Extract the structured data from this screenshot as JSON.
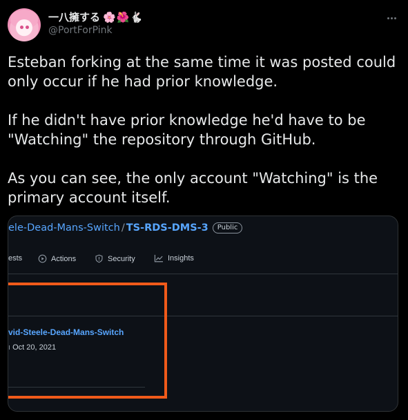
{
  "author": {
    "display_name": "一八擁する",
    "emoji": "🌸🌺🐇",
    "handle": "@PortForPink",
    "avatar_icon": "anime-avatar-icon"
  },
  "tweet": {
    "paragraphs": [
      [
        "Esteban forking at the same time it was posted could",
        "only occur if he had prior knowledge."
      ],
      [
        "If he didn't have prior knowledge he'd have to be",
        "\"Watching\" the repository through GitHub."
      ],
      [
        "As you can see, the only account \"Watching\" is the",
        "primary account itself."
      ]
    ]
  },
  "screenshot": {
    "repo_owner": "ele-Dead-Mans-Switch",
    "repo_separator": "/",
    "repo_name": "TS-RDS-DMS-3",
    "visibility_badge": "Public",
    "tabs": [
      {
        "label": "ests",
        "icon": ""
      },
      {
        "label": "Actions",
        "icon": "play-circle-icon"
      },
      {
        "label": "Security",
        "icon": "shield-icon"
      },
      {
        "label": "Insights",
        "icon": "graph-icon"
      }
    ],
    "watcher_name": "vid-Steele-Dead-Mans-Switch",
    "watcher_date": "Oct 20, 2021",
    "highlight_color": "#f05a1a",
    "link_color": "#58a6ff"
  }
}
